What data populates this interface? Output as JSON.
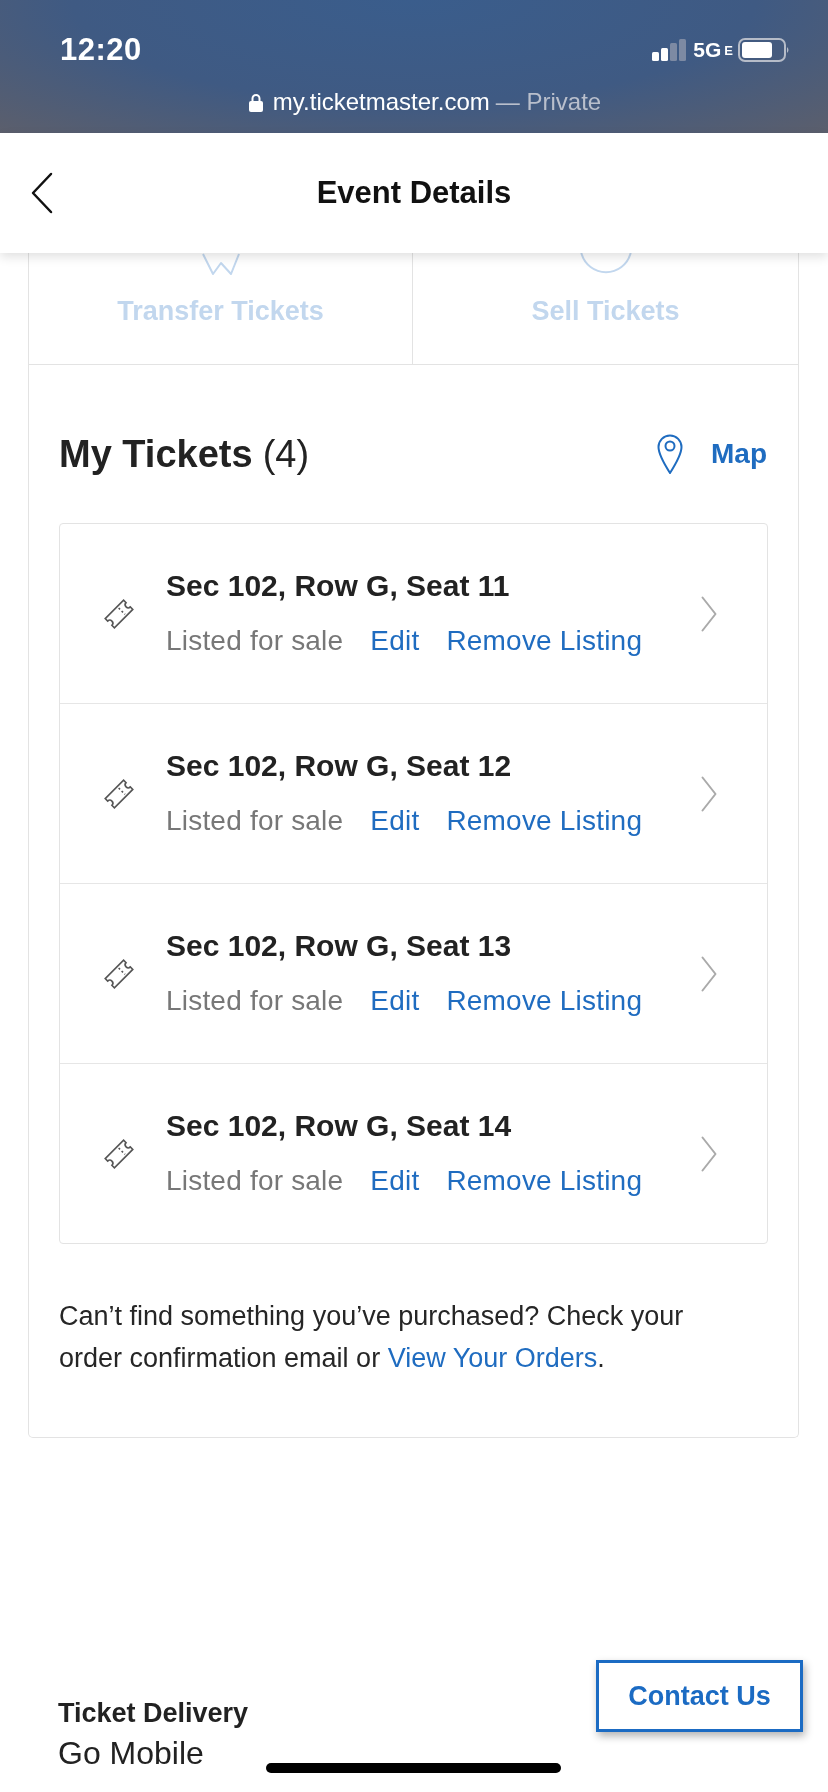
{
  "status_bar": {
    "time": "12:20",
    "network": "5G",
    "network_suffix": "E"
  },
  "browser_bar": {
    "url": "my.ticketmaster.com",
    "mode": "— Private"
  },
  "header": {
    "title": "Event Details"
  },
  "actions": [
    {
      "label": "Transfer Tickets",
      "kind": "transfer",
      "disabled": true
    },
    {
      "label": "Sell Tickets",
      "kind": "sell",
      "disabled": true
    }
  ],
  "tickets_section": {
    "title": "My Tickets",
    "count": "(4)",
    "map_link": "Map"
  },
  "tickets": [
    {
      "seat": "Sec 102, Row G, Seat 11",
      "status": "Listed for sale",
      "edit_link": "Edit",
      "remove_link": "Remove Listing"
    },
    {
      "seat": "Sec 102, Row G, Seat 12",
      "status": "Listed for sale",
      "edit_link": "Edit",
      "remove_link": "Remove Listing"
    },
    {
      "seat": "Sec 102, Row G, Seat 13",
      "status": "Listed for sale",
      "edit_link": "Edit",
      "remove_link": "Remove Listing"
    },
    {
      "seat": "Sec 102, Row G, Seat 14",
      "status": "Listed for sale",
      "edit_link": "Edit",
      "remove_link": "Remove Listing"
    }
  ],
  "help": {
    "text": "Can’t find something you’ve purchased? Check your order confirmation email or",
    "link": "View Your Orders",
    "end": "."
  },
  "footer": {
    "title": "Ticket Delivery",
    "value": "Go Mobile",
    "contact_button": "Contact Us"
  }
}
